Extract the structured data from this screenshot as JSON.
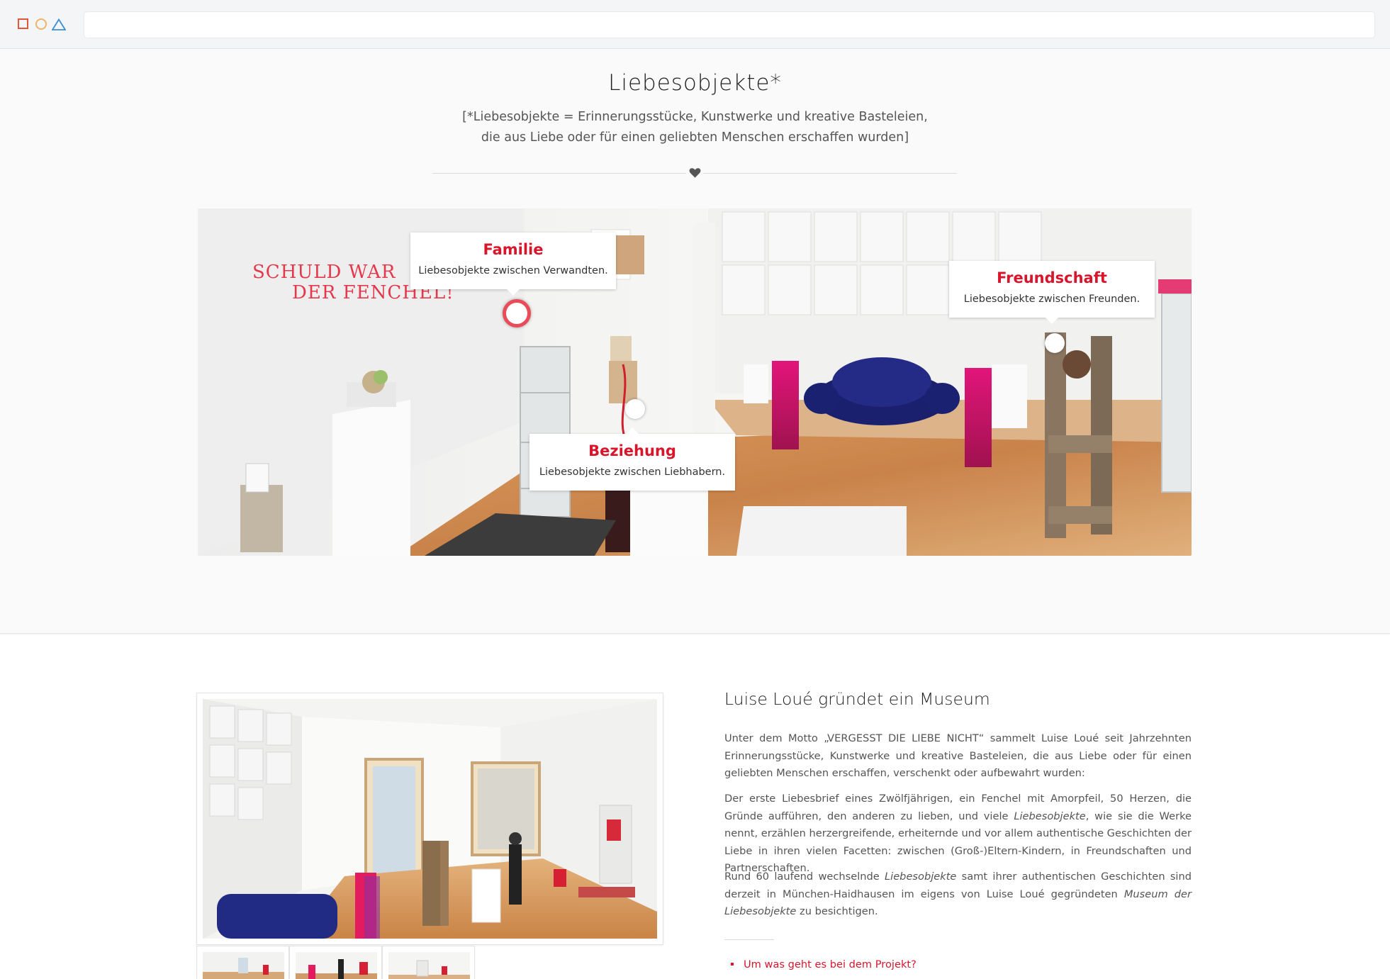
{
  "browser": {
    "window_buttons": [
      "square-icon",
      "circle-icon",
      "triangle-icon"
    ],
    "address": ""
  },
  "hero": {
    "title": "Liebesobjekte*",
    "subtitle_line1": "[*Liebesobjekte = Erinnerungsstücke, Kunstwerke und kreative Basteleien,",
    "subtitle_line2": "die aus Liebe oder für einen geliebten Menschen erschaffen wurden]",
    "divider_icon": "heart-icon",
    "wall_text_line1": "SCHULD WAR",
    "wall_text_line2": "DER FENCHEL!",
    "hotspots": [
      {
        "title": "Familie",
        "text": "Liebesobjekte zwischen Verwandten."
      },
      {
        "title": "Freundschaft",
        "text": "Liebesobjekte zwischen Freunden."
      },
      {
        "title": "Beziehung",
        "text": "Liebesobjekte zwischen Liebhabern."
      }
    ]
  },
  "article": {
    "title": "Luise Loué gründet ein Museum",
    "p1": "Unter dem Motto „VERGESST DIE LIEBE NICHT“ sammelt Luise Loué seit Jahrzehnten Erinnerungsstücke, Kunstwerke und kreative Basteleien, die aus Liebe oder für einen geliebten Menschen erschaffen, verschenkt oder aufbewahrt wurden:",
    "p2a": "Der erste Liebesbrief eines Zwölfjährigen, ein Fenchel mit Amorpfeil, 50 Herzen, die Gründe aufführen, den anderen zu lieben, und viele ",
    "p2em": "Liebesobjekte",
    "p2b": ", wie sie die Werke nennt, erzählen herzergreifende, erheiternde und vor allem authentische Geschichten der Liebe in ihren vielen Facetten: zwischen (Groß-)Eltern-Kindern, in Freundschaften und Partnerschaften.",
    "p3a": "Rund 60 laufend wechselnde ",
    "p3em1": "Liebesobjekte",
    "p3b": " samt ihrer authentischen Geschichten sind derzeit in München-Haidhausen im eigens von Luise Loué gegründeten ",
    "p3em2": "Museum der Liebesobjekte",
    "p3c": " zu besichtigen.",
    "link": "Um was geht es bei dem Projekt?"
  },
  "colors": {
    "accent": "#d7162c",
    "hotspot_ring": "#ea4b58",
    "hero_bg": "#fafafa"
  }
}
